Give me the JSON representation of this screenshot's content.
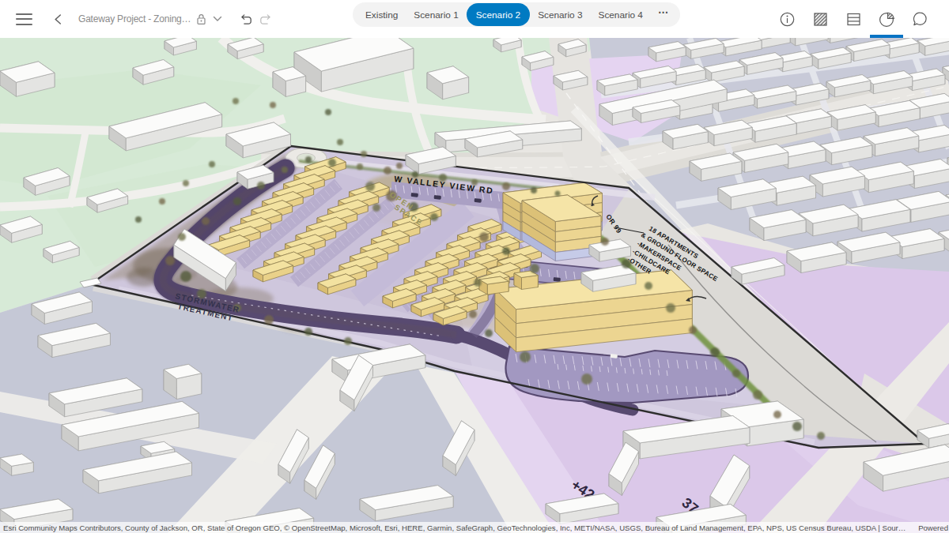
{
  "header": {
    "title": "Gateway Project - Zoning…"
  },
  "tabs": {
    "items": [
      "Existing",
      "Scenario 1",
      "Scenario 2",
      "Scenario 3",
      "Scenario 4"
    ],
    "selected": "Scenario 2",
    "more": "⋯"
  },
  "colors": {
    "accent": "#007ac2",
    "site_road": "#584a71",
    "site_ground": "#cdc5db",
    "building_yellow": "#f3e2a0",
    "zone_green": "#d7ead7",
    "zone_bluegray": "#c6c8d7",
    "zone_pink": "#dcc7ea"
  },
  "map_labels": {
    "road": "W VALLEY VIEW RD",
    "highway": "OR 99",
    "stormwater_line1": "STORMWATER",
    "stormwater_line2": "TREATMENT",
    "open_space_line1": "OPEN",
    "open_space_line2": "SPACE",
    "note_line1": "18 APARTMENTS",
    "note_line2": "& GROUND FLOOR SPACE",
    "note_line3": "-MAKERSPACE",
    "note_line4": "-CHILDCARE",
    "note_line5": "-OTHER",
    "elevation_a": "+42",
    "elevation_b": "37"
  },
  "attribution": {
    "sources": "Esri Community Maps Contributors, County of Jackson, OR, State of Oregon GEO, © OpenStreetMap, Microsoft, Esri, HERE, Garmin, SafeGraph, GeoTechnologies, Inc, METI/NASA, USGS, Bureau of Land Management, EPA, NPS, US Census Bureau, USDA | Sour…",
    "powered": "Powered"
  }
}
